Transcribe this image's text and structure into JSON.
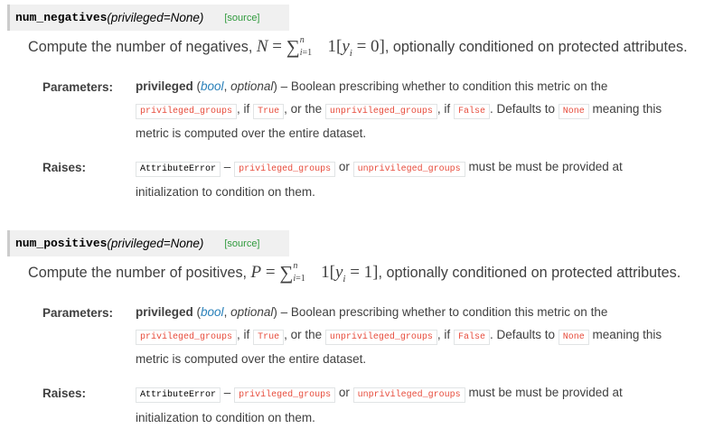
{
  "entries": [
    {
      "name": "num_negatives",
      "params": "(privileged=None)",
      "source": "[source]",
      "summary_pre": "Compute the number of negatives,",
      "math_var": "N",
      "math_cond": "0",
      "summary_post": ", optionally conditioned on protected attributes.",
      "parameters_label": "Parameters:",
      "param_name": "privileged",
      "param_type": "bool",
      "param_opt": "optional",
      "param_desc": "Boolean prescribing whether to condition this metric on the",
      "code_priv": "privileged_groups",
      "word_if": ", if",
      "code_true": "True",
      "word_or": ", or the",
      "code_unpriv": "unprivileged_groups",
      "word_if2": ", if",
      "code_false": "False",
      "word_defaults": ". Defaults to",
      "code_none": "None",
      "word_meaning": "meaning this",
      "line3": "metric is computed over the entire dataset.",
      "raises_label": "Raises:",
      "code_attrerr": "AttributeError",
      "dash": "–",
      "raise_code_priv": "privileged_groups",
      "raise_or": "or",
      "raise_code_unpriv": "unprivileged_groups",
      "raise_mid": "must be must be provided at",
      "raise_line2": "initialization to condition on them."
    },
    {
      "name": "num_positives",
      "params": "(privileged=None)",
      "source": "[source]",
      "summary_pre": "Compute the number of positives,",
      "math_var": "P",
      "math_cond": "1",
      "summary_post": ", optionally conditioned on protected attributes.",
      "parameters_label": "Parameters:",
      "param_name": "privileged",
      "param_type": "bool",
      "param_opt": "optional",
      "param_desc": "Boolean prescribing whether to condition this metric on the",
      "code_priv": "privileged_groups",
      "word_if": ", if",
      "code_true": "True",
      "word_or": ", or the",
      "code_unpriv": "unprivileged_groups",
      "word_if2": ", if",
      "code_false": "False",
      "word_defaults": ". Defaults to",
      "code_none": "None",
      "word_meaning": "meaning this",
      "line3": "metric is computed over the entire dataset.",
      "raises_label": "Raises:",
      "code_attrerr": "AttributeError",
      "dash": "–",
      "raise_code_priv": "privileged_groups",
      "raise_or": "or",
      "raise_code_unpriv": "unprivileged_groups",
      "raise_mid": "must be must be provided at",
      "raise_line2": "initialization to condition on them."
    }
  ]
}
